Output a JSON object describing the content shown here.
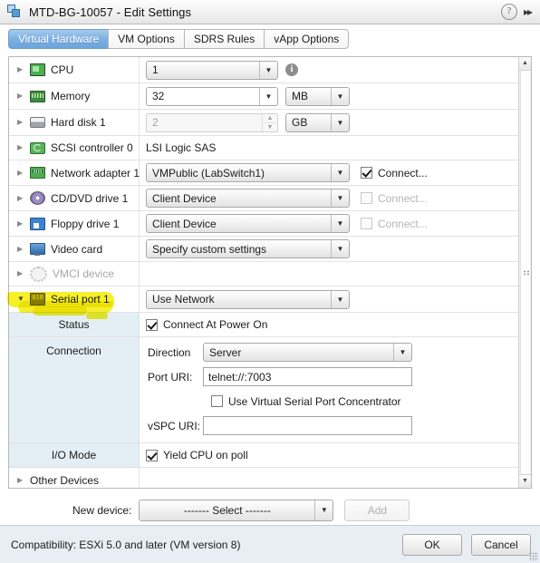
{
  "window": {
    "title": "MTD-BG-10057 - Edit Settings",
    "icon": "vm-icon",
    "help_icon": "?",
    "expand_icon": "▸▸"
  },
  "tabs": [
    {
      "label": "Virtual Hardware",
      "active": true
    },
    {
      "label": "VM Options",
      "active": false
    },
    {
      "label": "SDRS Rules",
      "active": false
    },
    {
      "label": "vApp Options",
      "active": false
    }
  ],
  "devices": {
    "cpu": {
      "label": "CPU",
      "value": "1",
      "info_icon": "i"
    },
    "memory": {
      "label": "Memory",
      "value": "32",
      "unit": "MB"
    },
    "harddisk": {
      "label": "Hard disk 1",
      "value": "2",
      "unit": "GB"
    },
    "scsi": {
      "label": "SCSI controller 0",
      "value": "LSI Logic SAS"
    },
    "network": {
      "label": "Network adapter 1",
      "value": "VMPublic (LabSwitch1)",
      "connect_label": "Connect...",
      "connect_checked": true
    },
    "cddvd": {
      "label": "CD/DVD drive 1",
      "value": "Client Device",
      "connect_label": "Connect...",
      "connect_checked": false
    },
    "floppy": {
      "label": "Floppy drive 1",
      "value": "Client Device",
      "connect_label": "Connect...",
      "connect_checked": false
    },
    "video": {
      "label": "Video card",
      "value": "Specify custom settings"
    },
    "vmci": {
      "label": "VMCI device",
      "value": ""
    },
    "serial": {
      "label": "Serial port 1",
      "value": "Use Network"
    },
    "other": {
      "label": "Other Devices"
    }
  },
  "serial_port_detail": {
    "status_label": "Status",
    "connect_at_power_on": "Connect At Power On",
    "connect_at_power_on_checked": true,
    "connection_label": "Connection",
    "direction_label": "Direction",
    "direction_value": "Server",
    "port_uri_label": "Port URI:",
    "port_uri_value": "telnet://:7003",
    "vspc_checkbox_label": "Use Virtual Serial Port Concentrator",
    "vspc_checkbox_checked": false,
    "vspc_uri_label": "vSPC URI:",
    "vspc_uri_value": "",
    "io_mode_label": "I/O Mode",
    "yield_cpu_label": "Yield CPU on poll",
    "yield_cpu_checked": true
  },
  "new_device": {
    "label": "New device:",
    "select_value": "------- Select -------",
    "add_label": "Add"
  },
  "footer": {
    "compatibility": "Compatibility: ESXi 5.0 and later (VM version 8)",
    "ok_label": "OK",
    "cancel_label": "Cancel"
  },
  "scrollbar": {
    "up_arrow": "▲",
    "down_arrow": "▼"
  },
  "colors": {
    "accent": "#7cb0e2",
    "subrow_bg": "#e4eef5",
    "highlight": "#f5ef18",
    "footer_bg": "#e8eef3"
  }
}
